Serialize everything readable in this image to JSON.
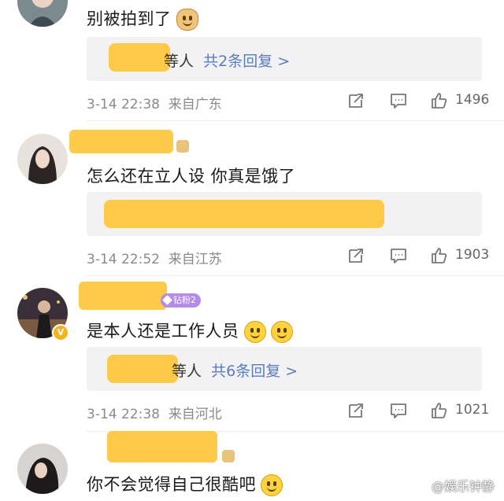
{
  "comments": [
    {
      "text": "别被拍到了",
      "reply_prefix": "等人",
      "reply_link": "共2条回复 >",
      "date": "3-14 22:38",
      "location": "来自广东",
      "likes": "1496"
    },
    {
      "text": "怎么还在立人设 你真是饿了",
      "date": "3-14 22:52",
      "location": "来自江苏",
      "likes": "1903"
    },
    {
      "text": "是本人还是工作人员",
      "fan_badge": "钻粉2",
      "reply_prefix": "等人",
      "reply_link": "共6条回复 >",
      "date": "3-14 22:38",
      "location": "来自河北",
      "likes": "1021"
    },
    {
      "text": "你不会觉得自己很酷吧"
    }
  ],
  "icons": {
    "share": "share-icon",
    "comment": "comment-icon",
    "like": "thumbs-up-icon"
  },
  "watermark": "@娱乐钟静",
  "colors": {
    "redaction": "#ffc63a",
    "reply_link": "#5a7bc0",
    "meta_gray": "#8a8a8a"
  }
}
